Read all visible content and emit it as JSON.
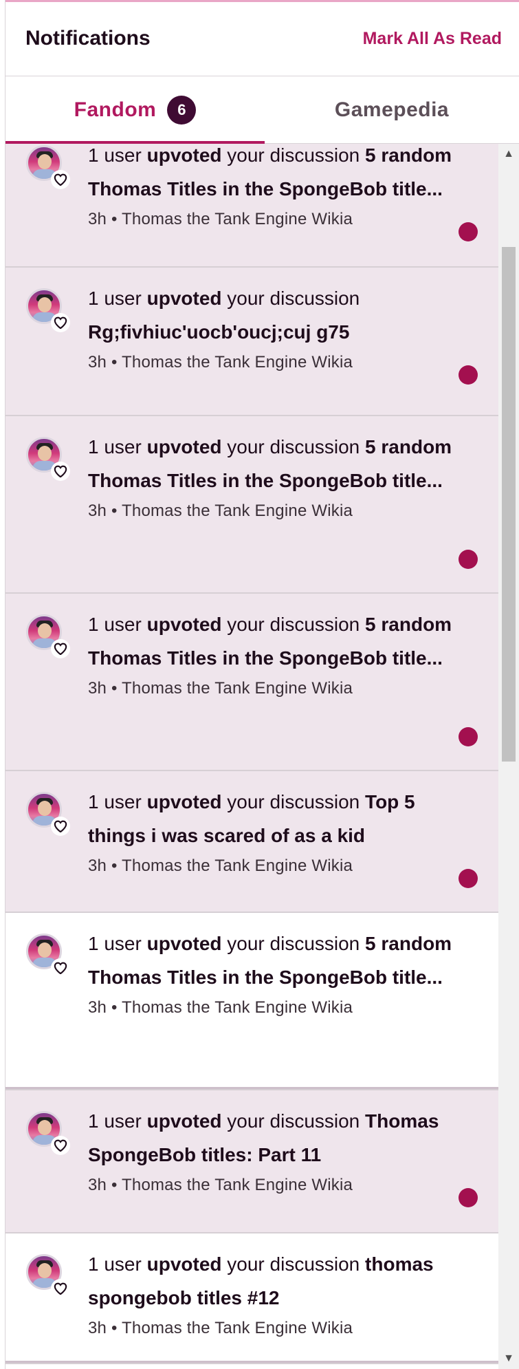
{
  "colors": {
    "accent": "#b1195f",
    "badge_bg": "#3f0b33",
    "unread_bg": "#efe5ec",
    "unread_dot": "#a3104f"
  },
  "header": {
    "title": "Notifications",
    "mark_all_label": "Mark All As Read"
  },
  "tabs": [
    {
      "label": "Fandom",
      "count": "6",
      "active": true
    },
    {
      "label": "Gamepedia",
      "active": false
    }
  ],
  "notifications": [
    {
      "prefix": "1 user ",
      "action": "upvoted",
      "middle": " your discussion ",
      "title": "5 random Thomas Titles in the SpongeBob title...",
      "time": "3h",
      "separator": "•",
      "wiki": "Thomas the Tank Engine Wikia",
      "unread": true,
      "avatar_icon": "user-avatar",
      "badge_icon": "heart-icon"
    },
    {
      "prefix": "1 user ",
      "action": "upvoted",
      "middle": " your discussion ",
      "title": "Rg;fivhiuc'uocb'oucj;cuj g75",
      "time": "3h",
      "separator": "•",
      "wiki": "Thomas the Tank Engine Wikia",
      "unread": true,
      "avatar_icon": "user-avatar",
      "badge_icon": "heart-icon"
    },
    {
      "prefix": "1 user ",
      "action": "upvoted",
      "middle": " your discussion ",
      "title": "5 random Thomas Titles in the SpongeBob title...",
      "time": "3h",
      "separator": "•",
      "wiki": "Thomas the Tank Engine Wikia",
      "unread": true,
      "avatar_icon": "user-avatar",
      "badge_icon": "heart-icon"
    },
    {
      "prefix": "1 user ",
      "action": "upvoted",
      "middle": " your discussion ",
      "title": "5 random Thomas Titles in the SpongeBob title...",
      "time": "3h",
      "separator": "•",
      "wiki": "Thomas the Tank Engine Wikia",
      "unread": true,
      "avatar_icon": "user-avatar",
      "badge_icon": "heart-icon"
    },
    {
      "prefix": "1 user ",
      "action": "upvoted",
      "middle": " your discussion ",
      "title": "Top 5 things i was scared of as a kid",
      "time": "3h",
      "separator": "•",
      "wiki": "Thomas the Tank Engine Wikia",
      "unread": true,
      "avatar_icon": "user-avatar",
      "badge_icon": "heart-icon"
    },
    {
      "prefix": "1 user ",
      "action": "upvoted",
      "middle": " your discussion ",
      "title": "5 random Thomas Titles in the SpongeBob title...",
      "time": "3h",
      "separator": "•",
      "wiki": "Thomas the Tank Engine Wikia",
      "unread": false,
      "avatar_icon": "user-avatar",
      "badge_icon": "heart-icon"
    },
    {
      "prefix": "1 user ",
      "action": "upvoted",
      "middle": " your discussion ",
      "title": "Thomas SpongeBob titles: Part 11",
      "time": "3h",
      "separator": "•",
      "wiki": "Thomas the Tank Engine Wikia",
      "unread": true,
      "avatar_icon": "user-avatar",
      "badge_icon": "heart-icon"
    },
    {
      "prefix": "1 user ",
      "action": "upvoted",
      "middle": " your discussion ",
      "title": "thomas spongebob titles #12",
      "time": "3h",
      "separator": "•",
      "wiki": "Thomas the Tank Engine Wikia",
      "unread": false,
      "avatar_icon": "user-avatar",
      "badge_icon": "heart-icon"
    }
  ],
  "scrollbar": {
    "up_icon": "scroll-up-arrow-icon",
    "down_icon": "scroll-down-arrow-icon"
  }
}
